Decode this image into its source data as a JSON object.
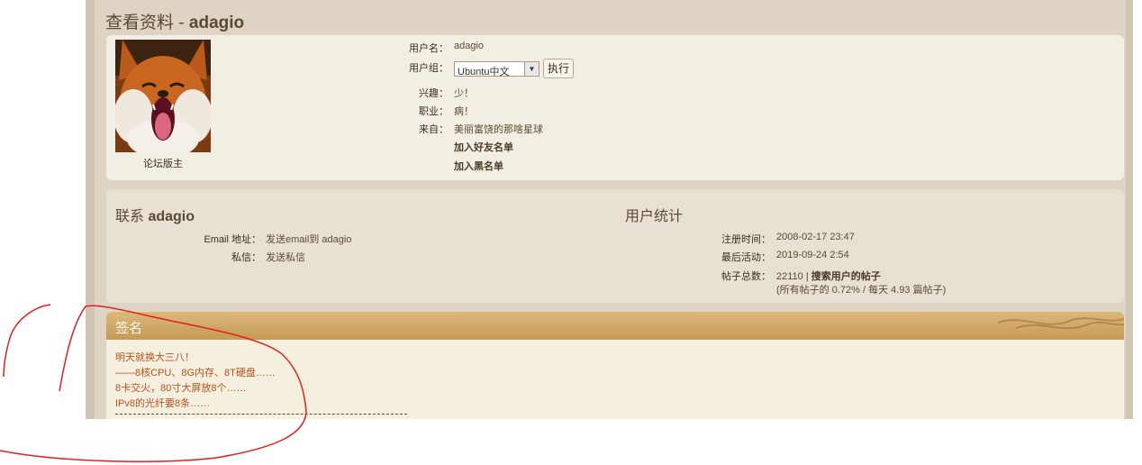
{
  "title": {
    "prefix": "查看资料 - ",
    "user": "adagio"
  },
  "profile": {
    "rank": "论坛版主",
    "username_label": "用户名：",
    "username": "adagio",
    "group_label": "用户组：",
    "group_selected": "Ubuntu中文",
    "go_button": "执行",
    "interests_label": "兴趣：",
    "interests": "少！",
    "occupation_label": "职业：",
    "occupation": "病！",
    "location_label": "来自：",
    "location": "美丽富饶的那啥星球",
    "add_friend": "加入好友名单",
    "add_foe": "加入黑名单"
  },
  "contact": {
    "heading_prefix": "联系 ",
    "heading_user": "adagio",
    "email_label": "Email 地址：",
    "email_value": "发送email到 adagio",
    "pm_label": "私信：",
    "pm_value": "发送私信"
  },
  "stats": {
    "heading": "用户统计",
    "joined_label": "注册时间：",
    "joined": "2008-02-17 23:47",
    "last_active_label": "最后活动：",
    "last_active": "2019-09-24 2:54",
    "posts_label": "帖子总数：",
    "posts_count": "22110",
    "posts_sep": " | ",
    "search_posts": "搜索用户的帖子",
    "posts_detail": "(所有帖子的 0.72% / 每天 4.93 篇帖子)"
  },
  "signature": {
    "heading": "签名",
    "lines": [
      "明天就换大三八！",
      "——8核CPU、8G内存、8T硬盘……",
      "8卡交火，80寸大屏放8个……",
      "IPv8的光纤要8条……"
    ]
  },
  "colors": {
    "accent": "#c59a55",
    "signature_text": "#b5521b",
    "annotation": "#e02020"
  },
  "icons": {
    "avatar": "fox-avatar-image",
    "select": "chevron-down-icon"
  }
}
